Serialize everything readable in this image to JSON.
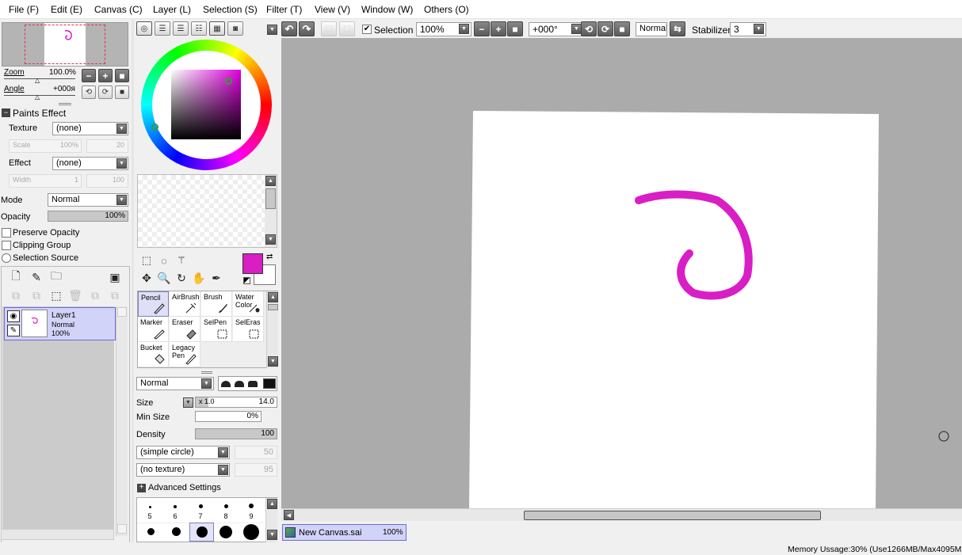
{
  "menu": [
    "File (F)",
    "Edit (E)",
    "Canvas (C)",
    "Layer (L)",
    "Selection (S)",
    "Filter (T)",
    "View (V)",
    "Window (W)",
    "Others (O)"
  ],
  "navigator": {
    "zoom_label": "Zoom",
    "zoom_value": "100.0%",
    "angle_label": "Angle",
    "angle_value": "+000я"
  },
  "paints_effect": {
    "header": "Paints Effect",
    "texture_label": "Texture",
    "texture_value": "(none)",
    "scale_label": "Scale",
    "scale_value": "100%",
    "scale_num": "20",
    "effect_label": "Effect",
    "effect_value": "(none)",
    "width_label": "Width",
    "width_value": "1",
    "width_num": "100"
  },
  "layer_props": {
    "mode_label": "Mode",
    "mode_value": "Normal",
    "opacity_label": "Opacity",
    "opacity_value": "100%",
    "opacity_fraction": 1.0,
    "preserve_opacity": "Preserve Opacity",
    "clipping_group": "Clipping Group",
    "selection_source": "Selection Source"
  },
  "layers": [
    {
      "name": "Layer1",
      "mode": "Normal",
      "opacity": "100%"
    }
  ],
  "colors": {
    "primary": "#d81ec4",
    "secondary": "#ffffff",
    "stroke": "#d81ec4",
    "canvas_bg": "#ababab"
  },
  "tools": [
    {
      "label": "Pencil",
      "icon": "pencil-icon",
      "selected": true
    },
    {
      "label": "AirBrush",
      "icon": "airbrush-icon"
    },
    {
      "label": "Brush",
      "icon": "brush-icon"
    },
    {
      "label": "Water Color",
      "icon": "watercolor-icon"
    },
    {
      "label": "Marker",
      "icon": "marker-icon"
    },
    {
      "label": "Eraser",
      "icon": "eraser-icon"
    },
    {
      "label": "SelPen",
      "icon": "selpen-icon"
    },
    {
      "label": "SelEras",
      "icon": "seleras-icon"
    },
    {
      "label": "Bucket",
      "icon": "bucket-icon"
    },
    {
      "label": "Legacy Pen",
      "icon": "legacy-pen-icon"
    }
  ],
  "brush": {
    "blend_mode": "Normal",
    "size_label": "Size",
    "size_multiplier": "x 1.0",
    "size_value": "14.0",
    "min_size_label": "Min Size",
    "min_size_value": "0%",
    "density_label": "Density",
    "density_value": "100",
    "shape": "(simple circle)",
    "shape_num": "50",
    "texture": "(no texture)",
    "texture_num": "95",
    "advanced": "Advanced Settings",
    "sizes_row1": [
      "5",
      "6",
      "7",
      "8",
      "9"
    ]
  },
  "toolbar": {
    "selection_label": "Selection",
    "zoom": "100%",
    "angle": "+000°",
    "mode": "Normal",
    "stabilizer_label": "Stabilizer",
    "stabilizer_value": "3"
  },
  "document_tab": {
    "name": "New Canvas.sai",
    "zoom": "100%"
  },
  "status": "Memory Ussage:30% (Use1266MB/Max4095MB)"
}
